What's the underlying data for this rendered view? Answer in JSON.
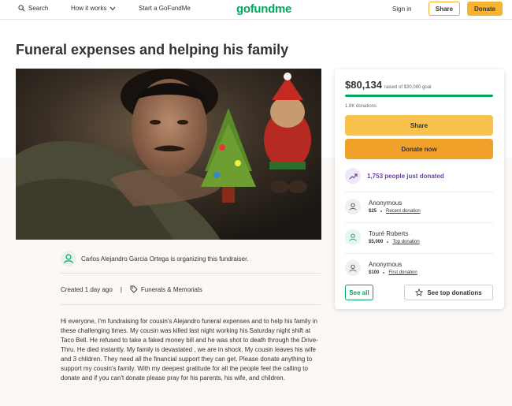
{
  "header": {
    "search_label": "Search",
    "how_it_works_label": "How it works",
    "start_label": "Start a GoFundMe",
    "logo_text": "gofundme",
    "signin_label": "Sign in",
    "share_label": "Share",
    "donate_label": "Donate"
  },
  "campaign": {
    "title": "Funeral expenses and helping his family",
    "organizer_text": "Carlos Alejandro Garcia Ortega is organizing this fundraiser.",
    "created_text": "Created 1 day ago",
    "separator": "|",
    "category": "Funerals & Memorials",
    "story": "Hi everyone, I'm fundraising for cousin's Alejandro funeral expenses and to help his family in these challenging times. My cousin was killed last night working his Saturday night shift at Taco Bell. He refused to take a faked money bill and he was shot to death through the Drive-Thru. He died instantly. My family is devastated , we are in shock. My cousin leaves his wife and 3 children. They need all the financial support they can get. Please donate anything to support my cousin's family. With my deepest gratitude for all the people feel the calling to donate and if you can't donate please pray for his parents, his wife, and children."
  },
  "card": {
    "raised_amount": "$80,134",
    "raised_goal": "raised of $30,000 goal",
    "progress_fraction": 1.0,
    "donations_count": "1.8K donations",
    "share_label": "Share",
    "donate_now_label": "Donate now",
    "just_donated": "1,753 people just donated",
    "donors": [
      {
        "name": "Anonymous",
        "amount": "$25",
        "tag": "Recent donation"
      },
      {
        "name": "Touré Roberts",
        "amount": "$5,000",
        "tag": "Top donation"
      },
      {
        "name": "Anonymous",
        "amount": "$100",
        "tag": "First donation"
      }
    ],
    "see_all_label": "See all",
    "see_top_label": "See top donations"
  },
  "colors": {
    "brand_green": "#02a95c",
    "donate_orange": "#f0a12a",
    "share_yellow": "#f9c24c",
    "purple": "#6b3fa0"
  }
}
